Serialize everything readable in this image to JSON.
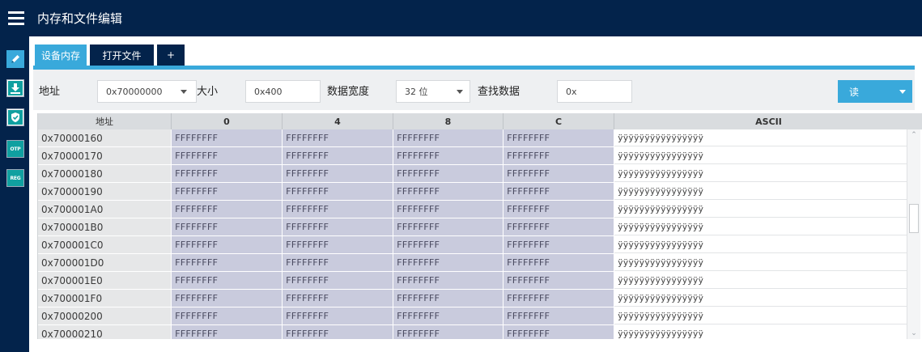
{
  "header": {
    "title": "内存和文件编辑"
  },
  "sidebar": {
    "items": [
      {
        "icon": "edit-icon",
        "active": true
      },
      {
        "icon": "download-icon",
        "active": false
      },
      {
        "icon": "shield-icon",
        "active": false
      },
      {
        "icon": "otp-icon",
        "label": "OTP",
        "active": false
      },
      {
        "icon": "reg-icon",
        "label": "REG",
        "active": false
      }
    ]
  },
  "tabs": [
    {
      "label": "设备内存",
      "active": true
    },
    {
      "label": "打开文件",
      "active": false
    },
    {
      "label": "+",
      "active": false
    }
  ],
  "toolbar": {
    "address_label": "地址",
    "address_value": "0x70000000",
    "size_label": "大小",
    "size_value": "0x400",
    "width_label": "数据宽度",
    "width_value": "32 位",
    "find_label": "查找数据",
    "find_value": "0x",
    "read_label": "读"
  },
  "grid": {
    "columns": [
      "地址",
      "0",
      "4",
      "8",
      "C",
      "ASCII"
    ],
    "rows": [
      {
        "addr": "0x70000160",
        "v0": "FFFFFFFF",
        "v4": "FFFFFFFF",
        "v8": "FFFFFFFF",
        "vc": "FFFFFFFF",
        "ascii": "ÿÿÿÿÿÿÿÿÿÿÿÿÿÿÿÿ"
      },
      {
        "addr": "0x70000170",
        "v0": "FFFFFFFF",
        "v4": "FFFFFFFF",
        "v8": "FFFFFFFF",
        "vc": "FFFFFFFF",
        "ascii": "ÿÿÿÿÿÿÿÿÿÿÿÿÿÿÿÿ"
      },
      {
        "addr": "0x70000180",
        "v0": "FFFFFFFF",
        "v4": "FFFFFFFF",
        "v8": "FFFFFFFF",
        "vc": "FFFFFFFF",
        "ascii": "ÿÿÿÿÿÿÿÿÿÿÿÿÿÿÿÿ"
      },
      {
        "addr": "0x70000190",
        "v0": "FFFFFFFF",
        "v4": "FFFFFFFF",
        "v8": "FFFFFFFF",
        "vc": "FFFFFFFF",
        "ascii": "ÿÿÿÿÿÿÿÿÿÿÿÿÿÿÿÿ"
      },
      {
        "addr": "0x700001A0",
        "v0": "FFFFFFFF",
        "v4": "FFFFFFFF",
        "v8": "FFFFFFFF",
        "vc": "FFFFFFFF",
        "ascii": "ÿÿÿÿÿÿÿÿÿÿÿÿÿÿÿÿ"
      },
      {
        "addr": "0x700001B0",
        "v0": "FFFFFFFF",
        "v4": "FFFFFFFF",
        "v8": "FFFFFFFF",
        "vc": "FFFFFFFF",
        "ascii": "ÿÿÿÿÿÿÿÿÿÿÿÿÿÿÿÿ"
      },
      {
        "addr": "0x700001C0",
        "v0": "FFFFFFFF",
        "v4": "FFFFFFFF",
        "v8": "FFFFFFFF",
        "vc": "FFFFFFFF",
        "ascii": "ÿÿÿÿÿÿÿÿÿÿÿÿÿÿÿÿ"
      },
      {
        "addr": "0x700001D0",
        "v0": "FFFFFFFF",
        "v4": "FFFFFFFF",
        "v8": "FFFFFFFF",
        "vc": "FFFFFFFF",
        "ascii": "ÿÿÿÿÿÿÿÿÿÿÿÿÿÿÿÿ"
      },
      {
        "addr": "0x700001E0",
        "v0": "FFFFFFFF",
        "v4": "FFFFFFFF",
        "v8": "FFFFFFFF",
        "vc": "FFFFFFFF",
        "ascii": "ÿÿÿÿÿÿÿÿÿÿÿÿÿÿÿÿ"
      },
      {
        "addr": "0x700001F0",
        "v0": "FFFFFFFF",
        "v4": "FFFFFFFF",
        "v8": "FFFFFFFF",
        "vc": "FFFFFFFF",
        "ascii": "ÿÿÿÿÿÿÿÿÿÿÿÿÿÿÿÿ"
      },
      {
        "addr": "0x70000200",
        "v0": "FFFFFFFF",
        "v4": "FFFFFFFF",
        "v8": "FFFFFFFF",
        "vc": "FFFFFFFF",
        "ascii": "ÿÿÿÿÿÿÿÿÿÿÿÿÿÿÿÿ"
      },
      {
        "addr": "0x70000210",
        "v0": "FFFFFFFF",
        "v4": "FFFFFFFF",
        "v8": "FFFFFFFF",
        "vc": "FFFFFFFF",
        "ascii": "ÿÿÿÿÿÿÿÿÿÿÿÿÿÿÿÿ"
      }
    ]
  },
  "colors": {
    "header_bg": "#03234b",
    "accent": "#39a9db",
    "value_cell_bg": "#c9cbdd",
    "address_cell_bg": "#e6e7e8"
  }
}
